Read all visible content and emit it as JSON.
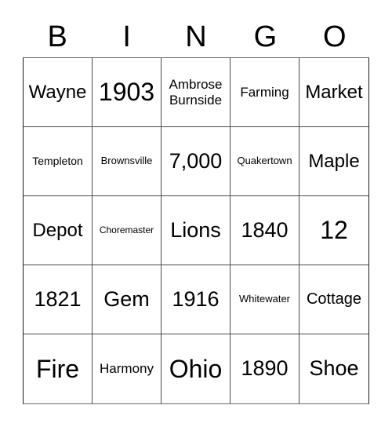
{
  "header": {
    "letters": [
      "B",
      "I",
      "N",
      "G",
      "O"
    ]
  },
  "cells": [
    [
      "Wayne",
      "1903",
      "Ambrose Burnside",
      "Farming",
      "Market"
    ],
    [
      "Templeton",
      "Brownsville",
      "7,000",
      "Quakertown",
      "Maple"
    ],
    [
      "Depot",
      "Choremaster",
      "Lions",
      "1840",
      "12"
    ],
    [
      "1821",
      "Gem",
      "1916",
      "Whitewater",
      "Cottage"
    ],
    [
      "Fire",
      "Harmony",
      "Ohio",
      "1890",
      "Shoe"
    ]
  ]
}
